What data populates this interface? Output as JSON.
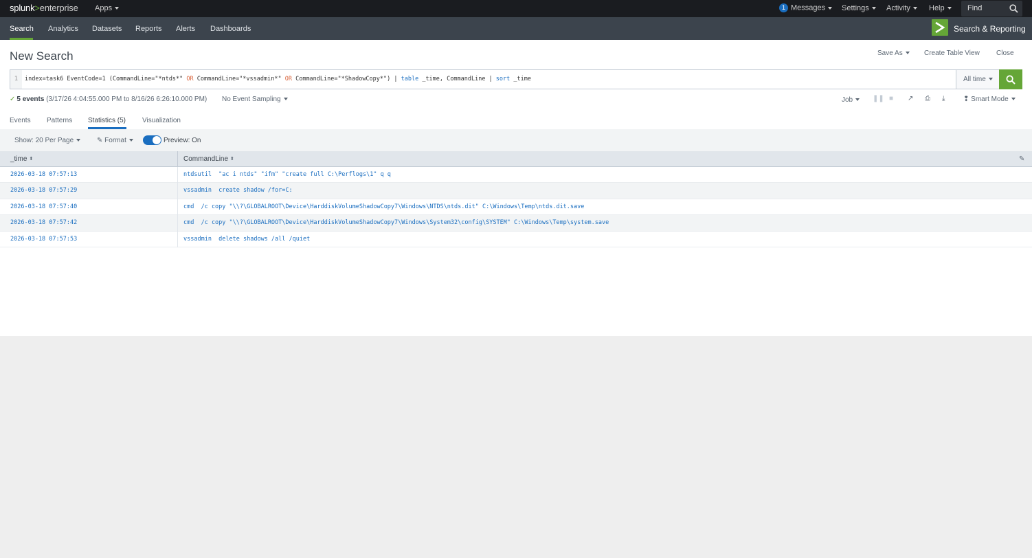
{
  "topbar": {
    "logo_splunk": "splunk",
    "logo_gt": ">",
    "logo_enterprise": "enterprise",
    "apps": "Apps",
    "messages_count": "1",
    "messages": "Messages",
    "settings": "Settings",
    "activity": "Activity",
    "help": "Help",
    "find": "Find"
  },
  "nav": {
    "items": [
      "Search",
      "Analytics",
      "Datasets",
      "Reports",
      "Alerts",
      "Dashboards"
    ],
    "active": "Search",
    "app_title": "Search & Reporting"
  },
  "header": {
    "title": "New Search",
    "save_as": "Save As",
    "create_table_view": "Create Table View",
    "close": "Close"
  },
  "search": {
    "line_number": "1",
    "query_parts": [
      {
        "text": "index=task6 EventCode=1 (CommandLine=\"*ntds*\" ",
        "type": "plain"
      },
      {
        "text": "OR",
        "type": "op"
      },
      {
        "text": " CommandLine=\"*vssadmin*\" ",
        "type": "plain"
      },
      {
        "text": "OR",
        "type": "op"
      },
      {
        "text": " CommandLine=\"*ShadowCopy*\") | ",
        "type": "plain"
      },
      {
        "text": "table",
        "type": "cmd"
      },
      {
        "text": " _time, CommandLine | ",
        "type": "plain"
      },
      {
        "text": "sort",
        "type": "cmd"
      },
      {
        "text": " _time",
        "type": "plain"
      }
    ],
    "time_range": "All time"
  },
  "status": {
    "count": "5 events",
    "range": "(3/17/26 4:04:55.000 PM to 8/16/26 6:26:10.000 PM)",
    "sampling": "No Event Sampling",
    "job": "Job",
    "mode": "Smart Mode"
  },
  "tabs": {
    "events": "Events",
    "patterns": "Patterns",
    "statistics": "Statistics (5)",
    "visualization": "Visualization"
  },
  "toolbar": {
    "per_page": "Show: 20 Per Page",
    "format": "Format",
    "preview": "Preview: On"
  },
  "table": {
    "columns": [
      "_time",
      "CommandLine"
    ],
    "rows": [
      {
        "time": "2026-03-18 07:57:13",
        "cmd": "ntdsutil  \"ac i ntds\" \"ifm\" \"create full C:\\Perflogs\\1\" q q"
      },
      {
        "time": "2026-03-18 07:57:29",
        "cmd": "vssadmin  create shadow /for=C:"
      },
      {
        "time": "2026-03-18 07:57:40",
        "cmd": "cmd  /c copy \"\\\\?\\GLOBALROOT\\Device\\HarddiskVolumeShadowCopy7\\Windows\\NTDS\\ntds.dit\" C:\\Windows\\Temp\\ntds.dit.save"
      },
      {
        "time": "2026-03-18 07:57:42",
        "cmd": "cmd  /c copy \"\\\\?\\GLOBALROOT\\Device\\HarddiskVolumeShadowCopy7\\Windows\\System32\\config\\SYSTEM\" C:\\Windows\\Temp\\system.save"
      },
      {
        "time": "2026-03-18 07:57:53",
        "cmd": "vssadmin  delete shadows /all /quiet"
      }
    ]
  },
  "colors": {
    "accent_green": "#65a637",
    "link_blue": "#1a6ec0",
    "query_operator": "#d9653d"
  }
}
